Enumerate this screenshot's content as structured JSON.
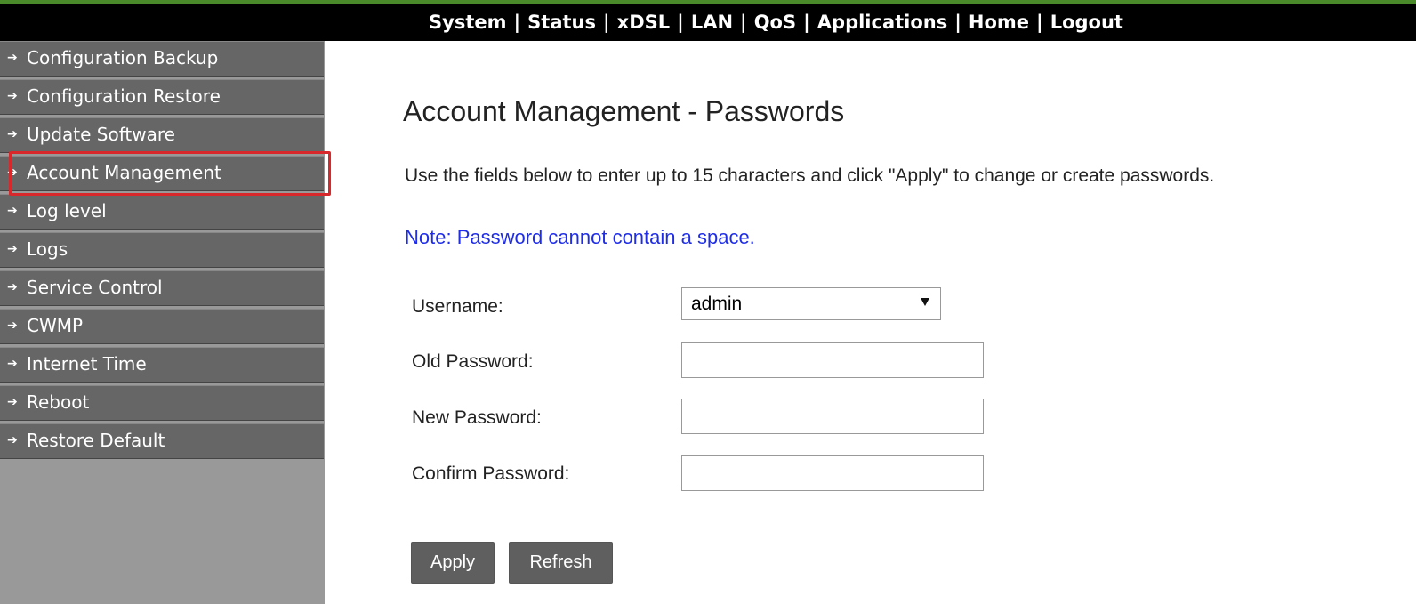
{
  "topnav": {
    "items": [
      "System",
      "Status",
      "xDSL",
      "LAN",
      "QoS",
      "Applications",
      "Home",
      "Logout"
    ],
    "separator": "|"
  },
  "sidebar": {
    "items": [
      {
        "label": "Configuration Backup"
      },
      {
        "label": "Configuration Restore"
      },
      {
        "label": "Update Software"
      },
      {
        "label": "Account Management",
        "active": true
      },
      {
        "label": "Log level"
      },
      {
        "label": "Logs"
      },
      {
        "label": "Service Control"
      },
      {
        "label": "CWMP"
      },
      {
        "label": "Internet Time"
      },
      {
        "label": "Reboot"
      },
      {
        "label": "Restore Default"
      }
    ]
  },
  "main": {
    "title": "Account Management - Passwords",
    "description": "Use the fields below to enter up to 15 characters and click \"Apply\" to change or create passwords.",
    "note": "Note: Password cannot contain a space.",
    "form": {
      "username_label": "Username:",
      "username_value": "admin",
      "old_password_label": "Old Password:",
      "new_password_label": "New Password:",
      "confirm_password_label": "Confirm Password:"
    },
    "buttons": {
      "apply": "Apply",
      "refresh": "Refresh"
    }
  },
  "colors": {
    "topbar_bg": "#000000",
    "sidebar_item_bg": "#666666",
    "sidebar_bg": "#999999",
    "note_text": "#1f2ee6",
    "highlight": "#d8282c"
  }
}
